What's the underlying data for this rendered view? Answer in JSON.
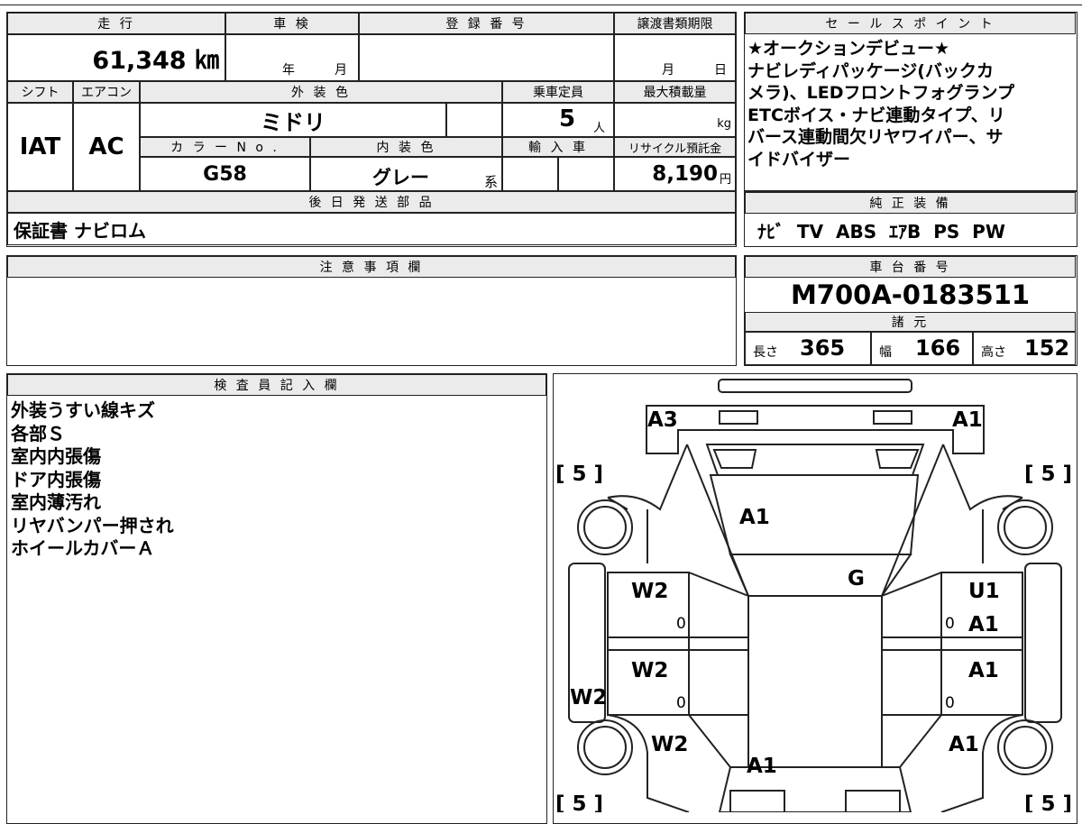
{
  "top_info": {
    "mileage_label": "走 行",
    "mileage_value": "61,348 ㎞",
    "shaken_label": "車 検",
    "shaken_year_unit": "年",
    "shaken_month_unit": "月",
    "registration_label": "登 録 番 号",
    "transfer_deadline_label": "譲渡書類期限",
    "transfer_month_unit": "月",
    "transfer_day_unit": "日",
    "shift_label": "シフト",
    "shift_value": "IAT",
    "aircon_label": "エアコン",
    "aircon_value": "AC",
    "exterior_color_label": "外 装 色",
    "exterior_color_value": "ミドリ",
    "capacity_label": "乗車定員",
    "capacity_value": "5",
    "capacity_unit": "人",
    "max_load_label": "最大積載量",
    "max_load_unit": "kg",
    "color_no_label": "カ ラ ー N o .",
    "color_no_value": "G58",
    "interior_color_label": "内 装 色",
    "interior_color_value": "グレー",
    "interior_color_suffix": "系",
    "import_label": "輸 入 車",
    "recycle_label": "リサイクル預託金",
    "recycle_value": "8,190",
    "recycle_unit": "円",
    "later_parts_label": "後 日 発 送 部 品",
    "later_parts_value": "保証書 ナビロム"
  },
  "sales_point": {
    "label": "セ ー ル ス ポ イ ン ト",
    "lines": [
      "★オークションデビュー★",
      "ナビレディパッケージ(バックカ",
      "メラ)、LEDフロントフォグランプ",
      "ETCボイス・ナビ連動タイプ、リ",
      "バース連動間欠リヤワイパー、サ",
      "イドバイザー"
    ]
  },
  "equipment": {
    "label": "純 正 装 備",
    "value": "ﾅﾋﾞ  TV  ABS  ｴｱB  PS  PW"
  },
  "notes": {
    "label": "注 意 事 項 欄",
    "value": ""
  },
  "chassis": {
    "label": "車 台 番 号",
    "value": "M700A-0183511"
  },
  "specs": {
    "label": "諸 元",
    "length_label": "長さ",
    "length_value": "365",
    "width_label": "幅",
    "width_value": "166",
    "height_label": "高さ",
    "height_value": "152"
  },
  "inspector": {
    "label": "検 査 員 記 入 欄",
    "lines": [
      "外装うすい線キズ",
      "各部Ｓ",
      "室内内張傷",
      "ドア内張傷",
      "室内薄汚れ",
      "リヤバンパー押され",
      "ホイールカバーＡ"
    ]
  },
  "diagram": {
    "marks": {
      "a3_left": "A3",
      "a1_right_top": "A1",
      "tire_fl": "[ 5 ]",
      "tire_fr": "[ 5 ]",
      "tire_rl": "[ 5 ]",
      "tire_rr": "[ 5 ]",
      "hood": "A1",
      "windshield": "G",
      "door_fl": "W2",
      "door_rl": "W2",
      "sill_left": "W2",
      "quarter_left": "W2",
      "door_fr_1": "U1",
      "door_fr_2": "A1",
      "door_rr": "A1",
      "quarter_right": "A1",
      "rear": "A1",
      "zero_1": "0",
      "zero_2": "0",
      "zero_3": "0",
      "zero_4": "0"
    }
  }
}
